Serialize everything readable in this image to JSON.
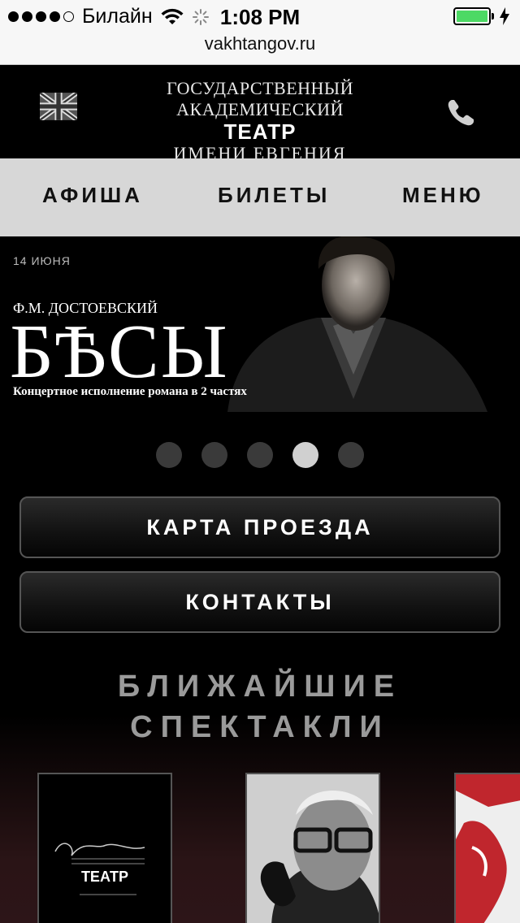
{
  "status_bar": {
    "carrier": "Билайн",
    "time": "1:08 PM"
  },
  "url": "vakhtangov.ru",
  "header": {
    "logo_line1": "ГОСУДАРСТВЕННЫЙ АКАДЕМИЧЕСКИЙ",
    "logo_line2": "ТЕАТР",
    "logo_line3": "ИМЕНИ ЕВГЕНИЯ ВАХТАНГОВА"
  },
  "nav": {
    "afisha": "АФИША",
    "tickets": "БИЛЕТЫ",
    "menu": "МЕНЮ"
  },
  "banner": {
    "date": "14 ИЮНЯ",
    "author": "Ф.М. ДОСТОЕВСКИЙ",
    "title": "БѢСЫ",
    "subtitle": "Концертное исполнение романа в 2 частях"
  },
  "pager": {
    "count": 5,
    "active_index": 3
  },
  "buttons": {
    "map": "КАРТА ПРОЕЗДА",
    "contacts": "КОНТАКТЫ"
  },
  "upcoming": {
    "line1": "БЛИЖАЙШИЕ",
    "line2": "СПЕКТАКЛИ"
  },
  "posters": {
    "poster1_caption": "ТЕАТР"
  },
  "colors": {
    "battery": "#4cd964",
    "nav_background": "#d7d7d7",
    "section_title": "#9a9a9a"
  }
}
